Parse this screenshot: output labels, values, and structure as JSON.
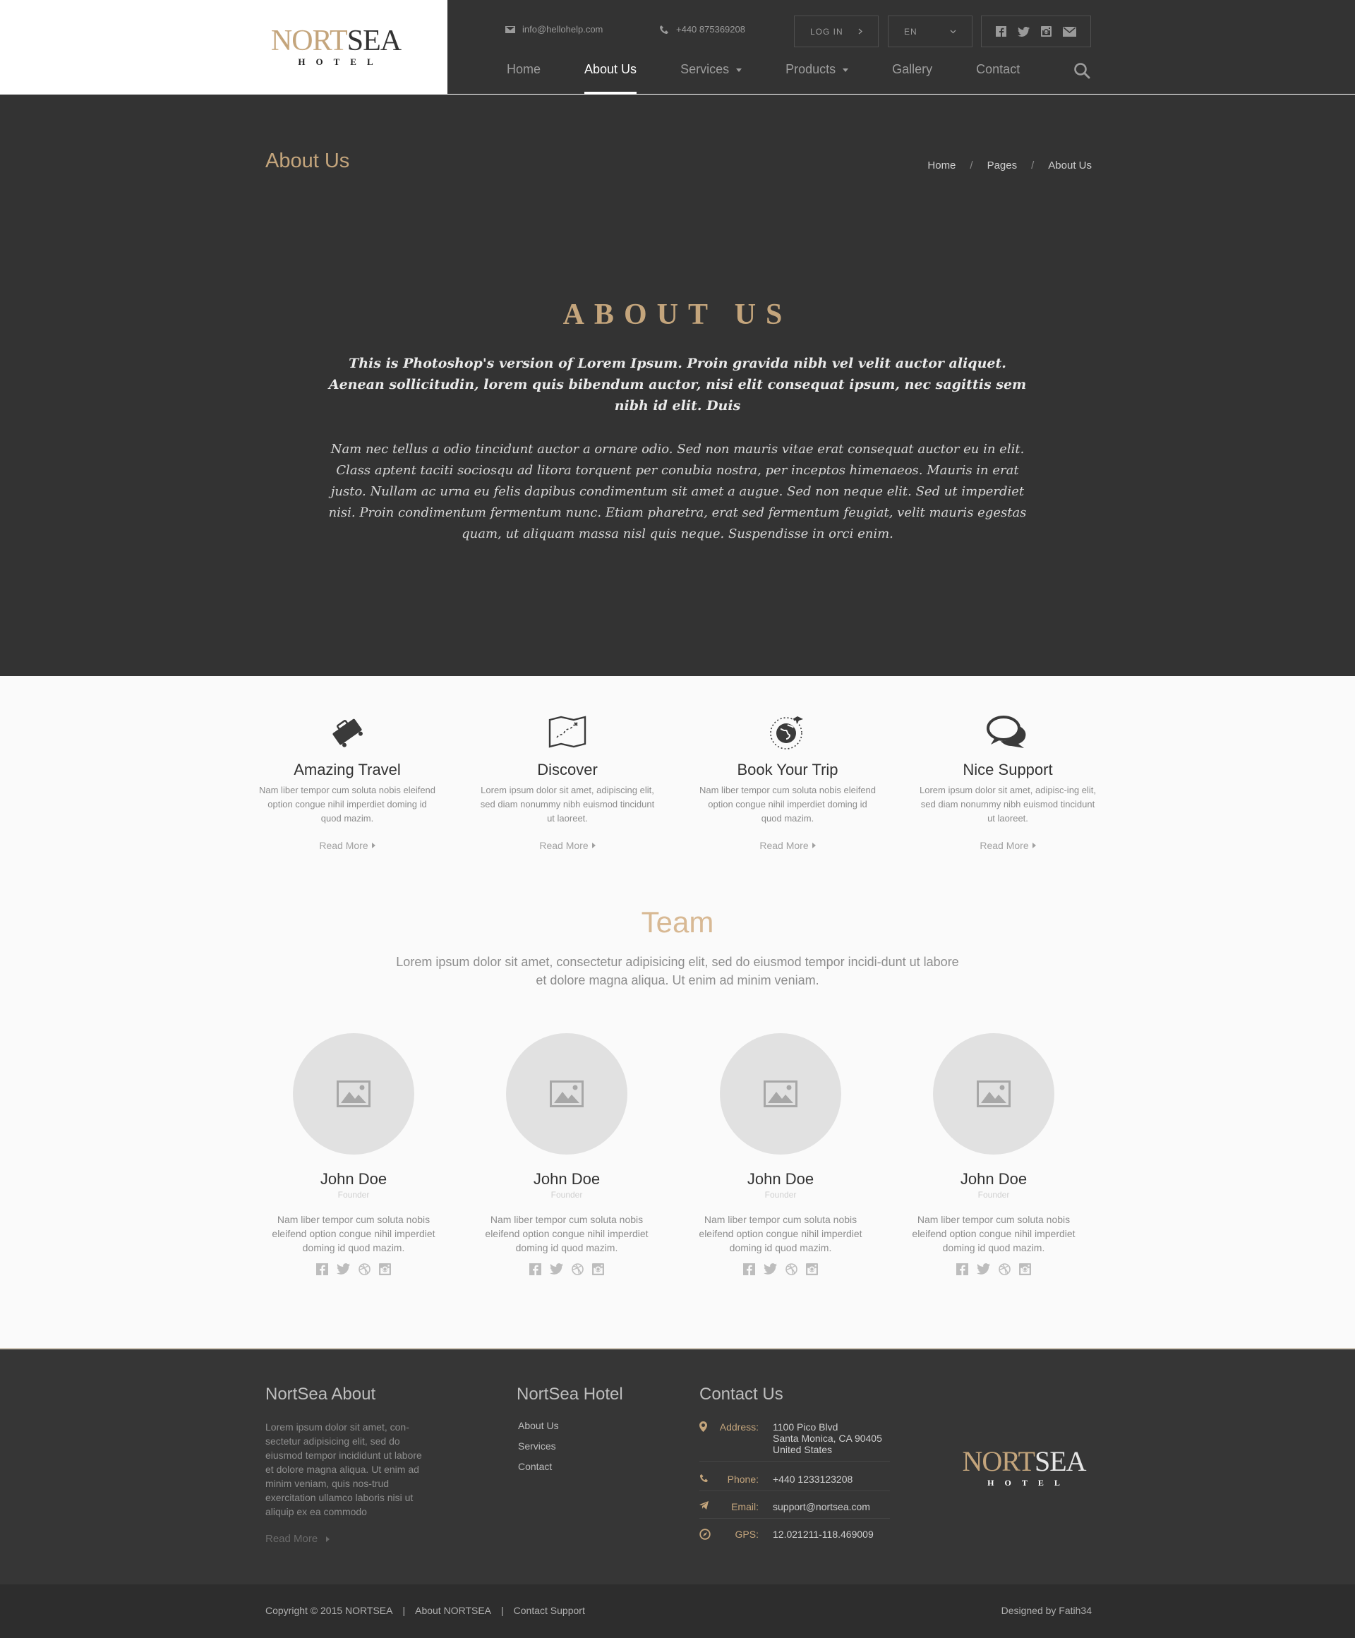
{
  "brand": {
    "logo_gold": "NORT",
    "logo_dark": "SEA",
    "logo_sub": "HOTEL"
  },
  "topbar": {
    "email": "info@hellohelp.com",
    "phone": "+440 875369208",
    "login_label": "LOG IN",
    "lang_label": "EN"
  },
  "nav": {
    "items": [
      {
        "label": "Home"
      },
      {
        "label": "About Us"
      },
      {
        "label": "Services"
      },
      {
        "label": "Products"
      },
      {
        "label": "Gallery"
      },
      {
        "label": "Contact"
      }
    ]
  },
  "page_header": {
    "title": "About Us",
    "breadcrumb": [
      "Home",
      "Pages",
      "About Us"
    ]
  },
  "about": {
    "title": "ABOUT US",
    "lead": "This is Photoshop's version  of Lorem Ipsum. Proin gravida nibh vel velit auctor aliquet. Aenean sollicitudin, lorem quis bibendum auctor, nisi elit consequat ipsum, nec sagittis sem nibh id elit. Duis",
    "body": "Nam nec tellus a odio tincidunt auctor a ornare odio. Sed non  mauris vitae erat consequat auctor eu in elit. Class aptent taciti sociosqu ad litora torquent per conubia nostra, per inceptos himenaeos. Mauris in erat justo. Nullam ac urna eu felis dapibus condimentum sit amet a augue. Sed non neque elit. Sed ut imperdiet nisi. Proin condimentum fermentum nunc. Etiam pharetra, erat sed fermentum feugiat, velit mauris egestas quam, ut aliquam massa nisl quis neque. Suspendisse in orci enim."
  },
  "features": [
    {
      "icon": "suitcase-icon",
      "title": "Amazing Travel",
      "desc": "Nam liber tempor cum soluta nobis eleifend option congue nihil imperdiet doming id quod mazim.",
      "more": "Read More"
    },
    {
      "icon": "map-icon",
      "title": "Discover",
      "desc": "Lorem ipsum dolor sit amet, adipiscing elit, sed diam nonummy nibh euismod tincidunt ut laoreet.",
      "more": "Read More"
    },
    {
      "icon": "globe-plane-icon",
      "title": "Book Your Trip",
      "desc": "Nam liber tempor cum soluta nobis eleifend option congue nihil imperdiet doming id quod mazim.",
      "more": "Read More"
    },
    {
      "icon": "chat-bubbles-icon",
      "title": "Nice Support",
      "desc": "Lorem ipsum dolor sit amet, adipisc-ing elit, sed diam nonummy nibh euismod tincidunt ut laoreet.",
      "more": "Read More"
    }
  ],
  "team": {
    "title": "Team",
    "desc": "Lorem ipsum dolor sit amet, consectetur adipisicing elit, sed do eiusmod tempor incidi-dunt ut labore et dolore magna aliqua. Ut enim ad minim veniam.",
    "members": [
      {
        "name": "John Doe",
        "role": "Founder",
        "desc": "Nam liber tempor cum soluta nobis eleifend option congue nihil imperdiet doming id quod mazim."
      },
      {
        "name": "John Doe",
        "role": "Founder",
        "desc": "Nam liber tempor cum soluta nobis eleifend option congue nihil imperdiet doming id quod mazim."
      },
      {
        "name": "John Doe",
        "role": "Founder",
        "desc": "Nam liber tempor cum soluta nobis eleifend option congue nihil imperdiet doming id quod mazim."
      },
      {
        "name": "John Doe",
        "role": "Founder",
        "desc": "Nam liber tempor cum soluta nobis eleifend option congue nihil imperdiet doming id quod mazim."
      }
    ]
  },
  "footer": {
    "about_title": "NortSea About",
    "about_text": "Lorem ipsum dolor sit amet, con-sectetur adipisicing elit, sed do eiusmod tempor incididunt ut labore et dolore magna aliqua. Ut enim ad minim veniam, quis nos-trud exercitation ullamco laboris nisi ut aliquip ex ea commodo",
    "about_more": "Read More",
    "hotel_title": "NortSea Hotel",
    "hotel_links": [
      "About Us",
      "Services",
      "Contact"
    ],
    "contact_title": "Contact Us",
    "address_label": "Address:",
    "address_lines": [
      "1100 Pico Blvd",
      "Santa Monica, CA 90405",
      "United States"
    ],
    "phone_label": "Phone:",
    "phone": "+440 1233123208",
    "email_label": "Email:",
    "email": "support@nortsea.com",
    "gps_label": "GPS:",
    "gps": "12.021211-118.469009"
  },
  "copyright": {
    "text": "Copyright © 2015 NORTSEA",
    "sep": "|",
    "link1": "About NORTSEA",
    "link2": "Contact Support",
    "designed": "Designed by Fatih34"
  },
  "colors": {
    "accent": "#c4a57c",
    "dark": "#333333",
    "light_bg": "#fafafa"
  }
}
